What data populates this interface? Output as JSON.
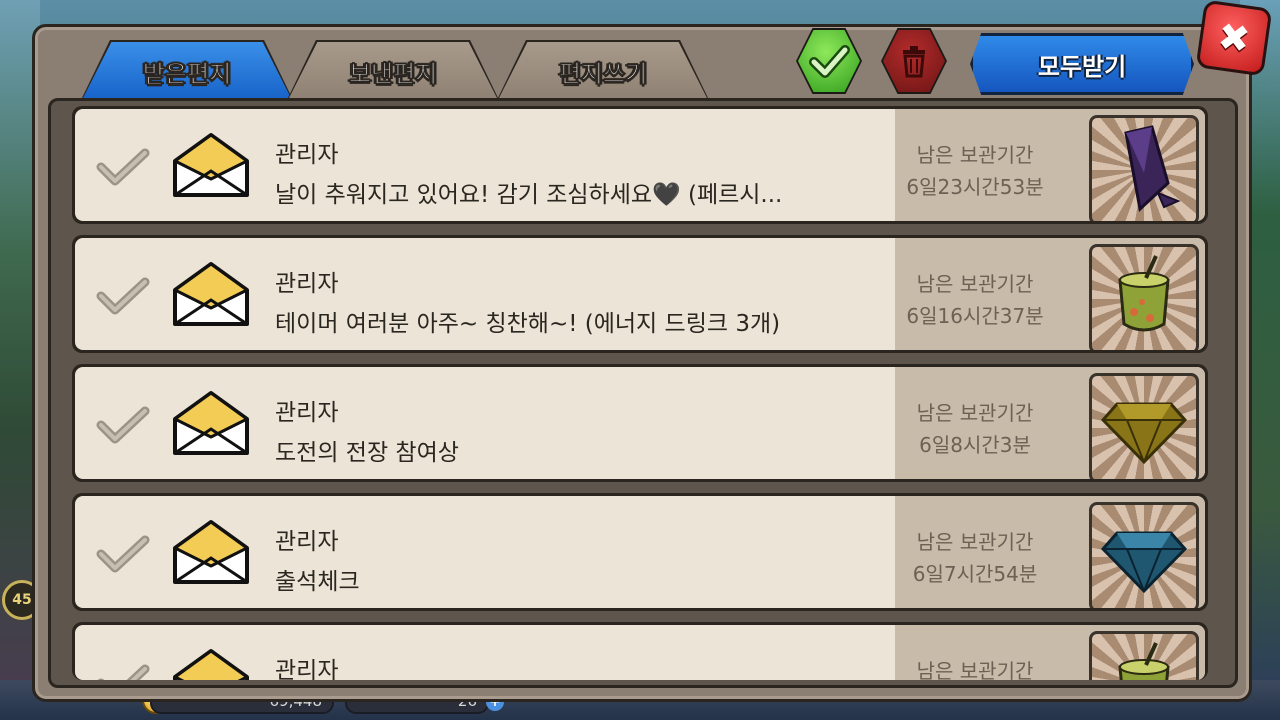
{
  "tabs": [
    {
      "label": "받은편지",
      "active": true
    },
    {
      "label": "보낸편지",
      "active": false
    },
    {
      "label": "편지쓰기",
      "active": false
    }
  ],
  "actions": {
    "select_all_icon": "check-icon",
    "delete_icon": "trash-icon",
    "claim_all_label": "모두받기",
    "close_icon": "close-icon"
  },
  "mail": [
    {
      "sender": "관리자",
      "title": "날이 추워지고 있어요! 감기 조심하세요🖤 (페르시...",
      "expire_label": "남은 보관기간",
      "expire_time": "6일23시간53분",
      "item_icon": "purple-crystal-icon"
    },
    {
      "sender": "관리자",
      "title": "테이머 여러분 아주~ 칭찬해~! (에너지 드링크 3개)",
      "expire_label": "남은 보관기간",
      "expire_time": "6일16시간37분",
      "item_icon": "energy-drink-icon"
    },
    {
      "sender": "관리자",
      "title": "도전의 전장 참여상",
      "expire_label": "남은 보관기간",
      "expire_time": "6일8시간3분",
      "item_icon": "gold-diamond-icon"
    },
    {
      "sender": "관리자",
      "title": "출석체크",
      "expire_label": "남은 보관기간",
      "expire_time": "6일7시간54분",
      "item_icon": "blue-diamond-icon"
    },
    {
      "sender": "관리자",
      "title": "",
      "expire_label": "남은 보관기간",
      "expire_time": "",
      "item_icon": "energy-drink-icon"
    }
  ],
  "resources": {
    "gold": "69,448",
    "gems": "26",
    "level": "45"
  },
  "colors": {
    "tab_active": "#1763c9",
    "panel": "#8b7e72",
    "row_bg": "#ece4d6",
    "row_right": "#c9bba9",
    "accent_green": "#2f9d1c",
    "accent_red": "#c31b1b"
  }
}
